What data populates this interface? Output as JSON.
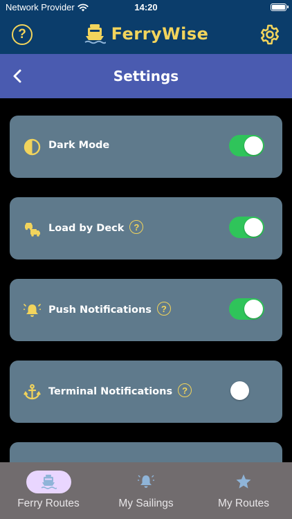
{
  "status_bar": {
    "carrier": "Network Provider",
    "time": "14:20"
  },
  "app_header": {
    "brand_name": "FerryWise",
    "help_icon": "question-circle-icon",
    "settings_icon": "gear-icon"
  },
  "nav": {
    "title": "Settings",
    "back_icon": "chevron-left-icon"
  },
  "settings": [
    {
      "label": "Dark Mode",
      "icon": "contrast-icon",
      "has_help": false,
      "enabled": true
    },
    {
      "label": "Load by Deck",
      "icon": "vehicles-icon",
      "has_help": true,
      "enabled": true
    },
    {
      "label": "Push Notifications",
      "icon": "bell-icon",
      "has_help": true,
      "enabled": true
    },
    {
      "label": "Terminal Notifications",
      "icon": "anchor-icon",
      "has_help": true,
      "enabled": false
    }
  ],
  "help_glyph": "?",
  "tabs": [
    {
      "label": "Ferry Routes",
      "icon": "ferry-icon",
      "selected": true
    },
    {
      "label": "My Sailings",
      "icon": "bell-icon",
      "selected": false
    },
    {
      "label": "My Routes",
      "icon": "star-icon",
      "selected": false
    }
  ],
  "colors": {
    "header_bg": "#0b3d6b",
    "brand_accent": "#f2d45c",
    "nav_bg": "#4a5bb0",
    "card_bg": "#5f7a8c",
    "toggle_on": "#2fc45a",
    "tabbar_bg": "#716c6e",
    "tab_selected_pill": "#e9d6ff",
    "tab_icon": "#8fb4d8"
  }
}
